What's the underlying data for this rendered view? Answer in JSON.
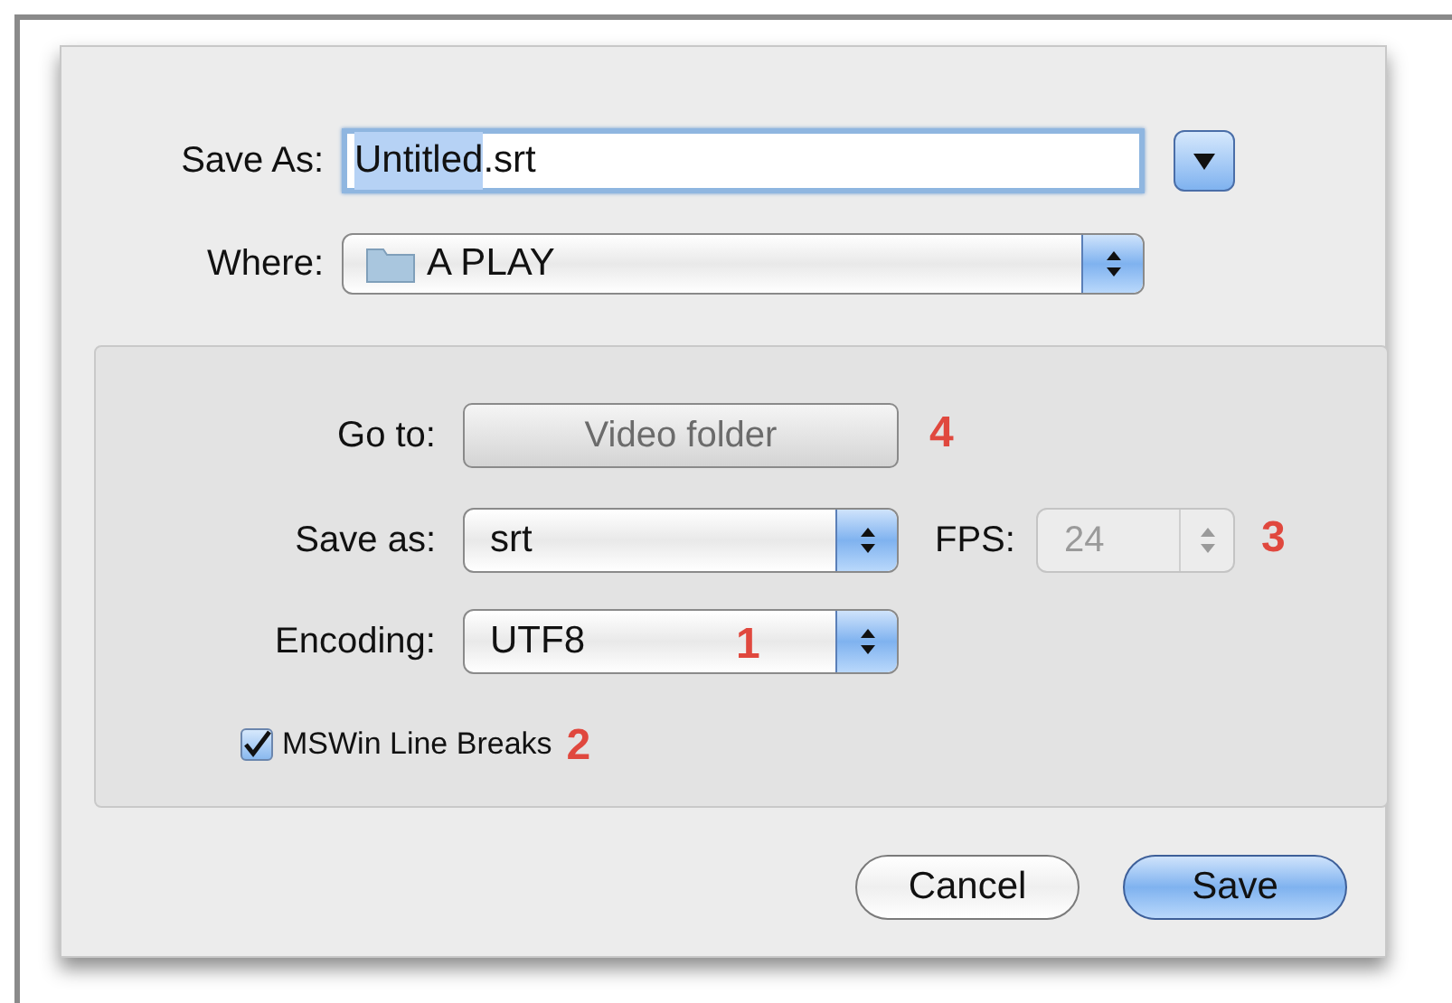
{
  "save_as": {
    "label": "Save As:",
    "selected_text": "Untitled",
    "unselected_text": ".srt"
  },
  "where": {
    "label": "Where:",
    "value": "A PLAY"
  },
  "options": {
    "go_to": {
      "label": "Go to:",
      "button": "Video folder",
      "disabled": true,
      "annotation": "4"
    },
    "format": {
      "label": "Save as:",
      "value": "srt"
    },
    "fps": {
      "label": "FPS:",
      "value": "24",
      "disabled": true,
      "annotation": "3"
    },
    "encoding": {
      "label": "Encoding:",
      "value": "UTF8",
      "annotation": "1"
    },
    "line_breaks": {
      "label": "MSWin Line Breaks",
      "checked": true,
      "annotation": "2"
    }
  },
  "buttons": [
    {
      "label": "Cancel",
      "default": false
    },
    {
      "label": "Save",
      "default": true
    }
  ]
}
